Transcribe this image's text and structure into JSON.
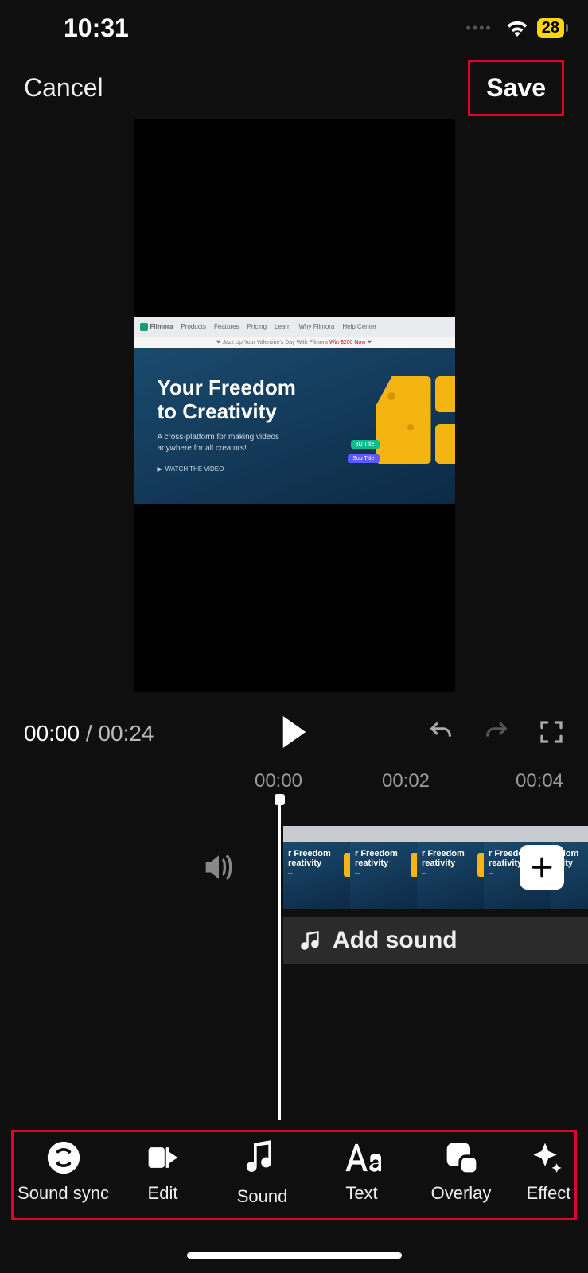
{
  "status_bar": {
    "time": "10:31",
    "battery": "28"
  },
  "header": {
    "cancel": "Cancel",
    "save": "Save"
  },
  "preview": {
    "brand": "Filmora",
    "nav": [
      "Products",
      "Features",
      "Pricing",
      "Learn",
      "Why Filmora",
      "Help Center"
    ],
    "promo_prefix": "Jazz Up Your Valentine's Day With Filmora ",
    "promo_accent": "Win $200 Now",
    "hero_title_line1": "Your Freedom",
    "hero_title_line2": "to Creativity",
    "hero_sub": "A cross-platform for making videos anywhere for all creators!",
    "watch": "WATCH THE VIDEO",
    "tag_3d": "3D Title",
    "tag_sub": "Sub Title"
  },
  "playback": {
    "current": "00:00",
    "total": "00:24"
  },
  "ruler": [
    "00:00",
    "00:02",
    "00:04"
  ],
  "clip_thumbs": [
    {
      "t1a": "r Freedom",
      "t1b": "reativity"
    },
    {
      "t1a": "r Freedom",
      "t1b": "reativity"
    },
    {
      "t1a": "r Freedom",
      "t1b": "reativity"
    },
    {
      "t1a": "r Freedom",
      "t1b": "reativity"
    },
    {
      "t1a": "edom",
      "t1b": "ivity"
    }
  ],
  "add_sound": "Add sound",
  "toolbar": [
    {
      "label": "Sound sync"
    },
    {
      "label": "Edit"
    },
    {
      "label": "Sound"
    },
    {
      "label": "Text"
    },
    {
      "label": "Overlay"
    },
    {
      "label": "Effect"
    }
  ]
}
